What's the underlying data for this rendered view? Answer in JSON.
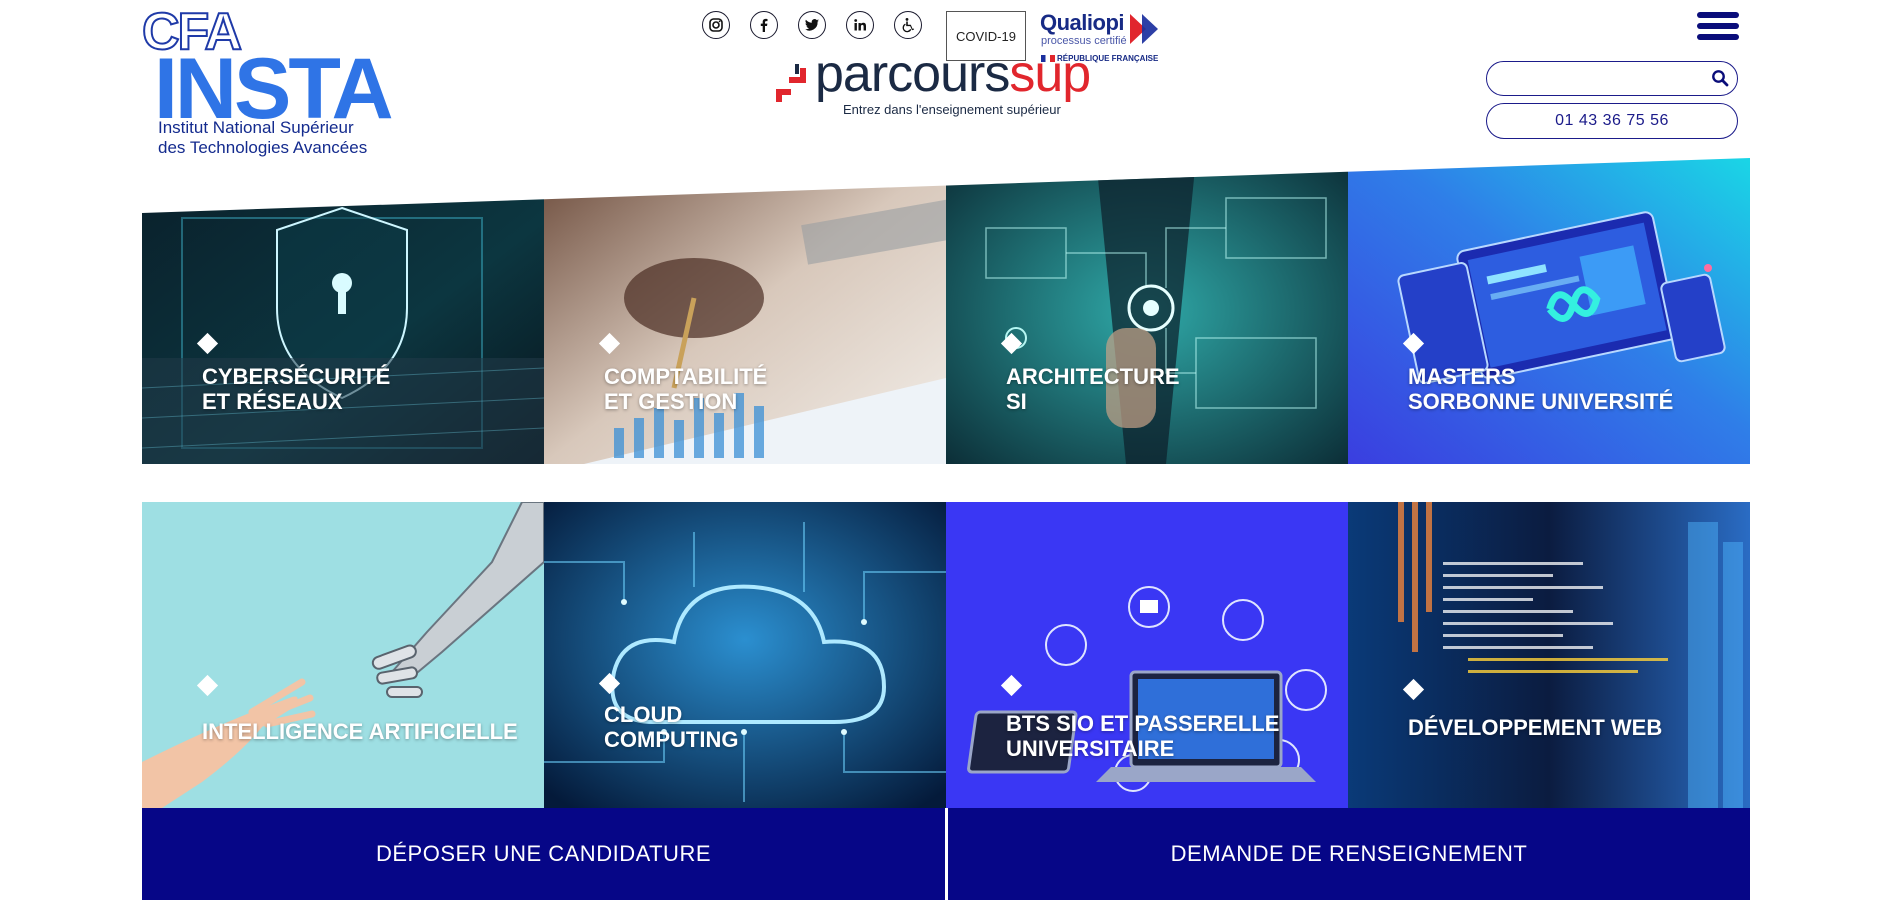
{
  "logo": {
    "cfa": "CFA",
    "insta": "INSTA",
    "line1": "Institut National Supérieur",
    "line2": "des Technologies Avancées"
  },
  "socials": [
    {
      "icon": "instagram-icon"
    },
    {
      "icon": "facebook-icon"
    },
    {
      "icon": "twitter-icon"
    },
    {
      "icon": "linkedin-icon"
    },
    {
      "icon": "accessibility-icon"
    }
  ],
  "covid_label": "COVID-19",
  "qualiopi": {
    "title": "Qualiopi",
    "subtitle": "processus certifié",
    "republic": "RÉPUBLIQUE FRANÇAISE"
  },
  "parcoursup": {
    "word_main": "parcours",
    "word_accent": "up",
    "word_s": "s",
    "tagline": "Entrez dans l'enseignement supérieur"
  },
  "search": {
    "value": "",
    "placeholder": ""
  },
  "phone": "01 43 36 75 56",
  "programs": [
    {
      "line1": "CYBERSÉCURITÉ",
      "line2": "ET RÉSEAUX"
    },
    {
      "line1": "COMPTABILITÉ",
      "line2": "ET GESTION"
    },
    {
      "line1": "ARCHITECTURE",
      "line2": "SI"
    },
    {
      "line1": "MASTERS",
      "line2": "SORBONNE UNIVERSITÉ"
    },
    {
      "line1": "INTELLIGENCE ARTIFICIELLE",
      "line2": ""
    },
    {
      "line1": "CLOUD",
      "line2": "COMPUTING"
    },
    {
      "line1": "BTS SIO ET PASSERELLE",
      "line2": "UNIVERSITAIRE"
    },
    {
      "line1": "DÉVELOPPEMENT WEB",
      "line2": ""
    }
  ],
  "cta": {
    "apply": "DÉPOSER UNE CANDIDATURE",
    "info": "DEMANDE DE RENSEIGNEMENT"
  },
  "colors": {
    "navy": "#060687",
    "brand_blue": "#2f74e6",
    "parcoursup_red": "#e1262d"
  }
}
